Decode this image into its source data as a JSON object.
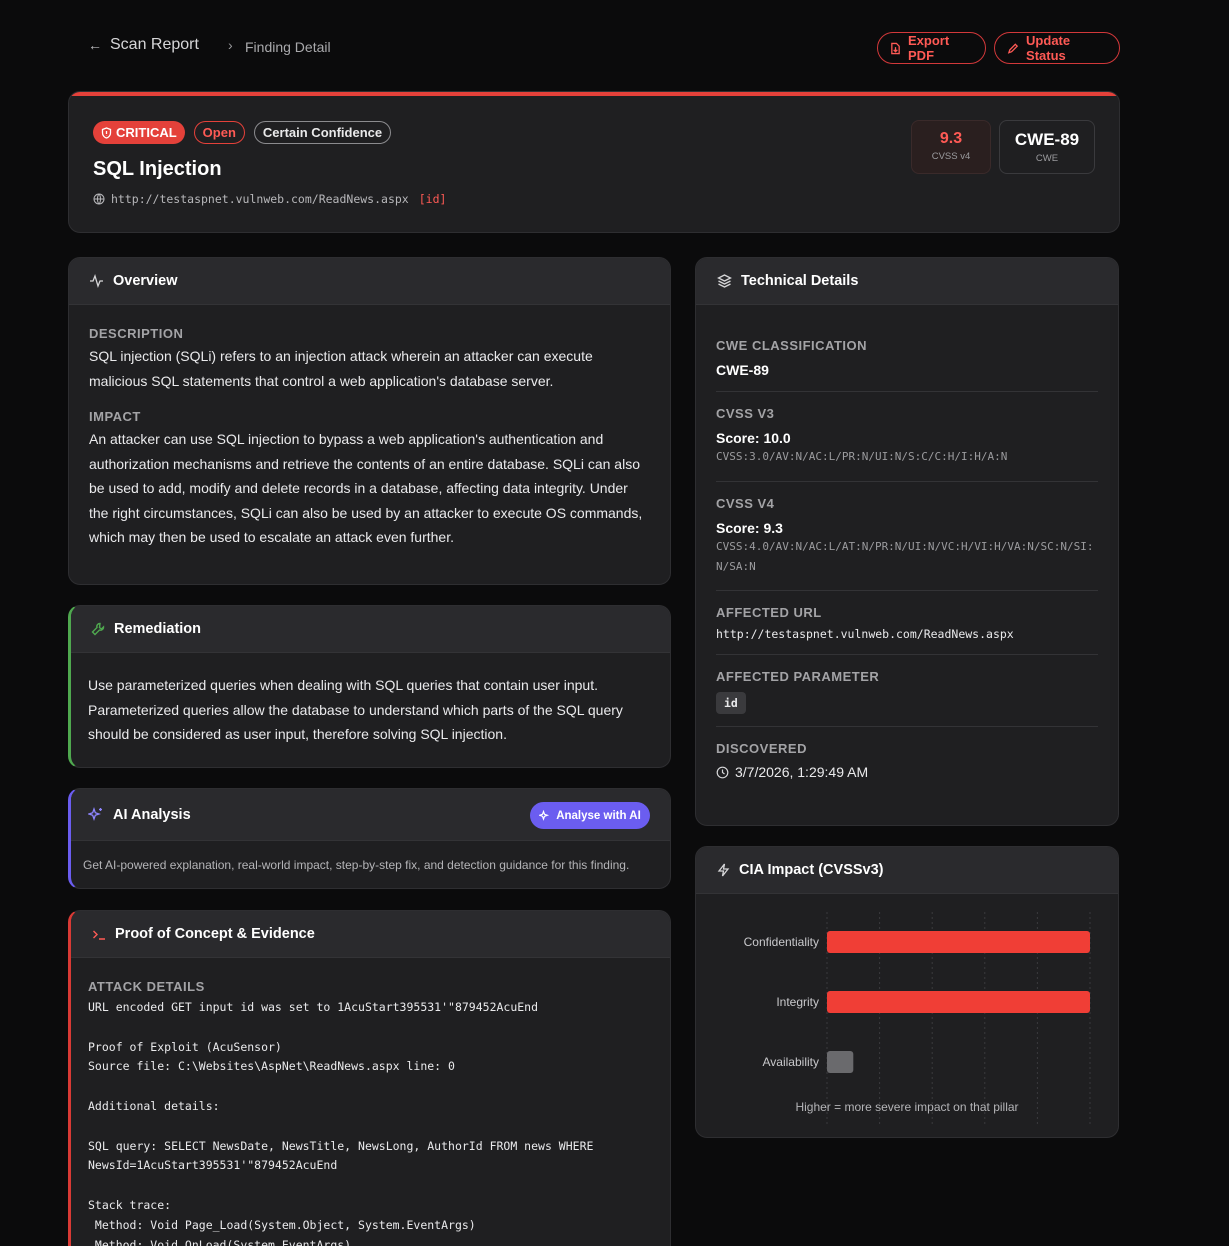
{
  "nav": {
    "back_label": "Scan Report",
    "current": "Finding Detail",
    "export_label": "Export PDF",
    "update_label": "Update Status"
  },
  "finding": {
    "severity": "CRITICAL",
    "status": "Open",
    "confidence": "Certain Confidence",
    "title": "SQL Injection",
    "url": "http://testaspnet.vulnweb.com/ReadNews.aspx",
    "param_tag": "[id]",
    "cvss_score": "9.3",
    "cvss_label": "CVSS v4",
    "cwe": "CWE-89",
    "cwe_label": "CWE"
  },
  "overview": {
    "title": "Overview",
    "description_label": "DESCRIPTION",
    "description": "SQL injection (SQLi) refers to an injection attack wherein an attacker can execute malicious SQL statements that control a web application's database server.",
    "impact_label": "IMPACT",
    "impact": "An attacker can use SQL injection to bypass a web application's authentication and authorization mechanisms and retrieve the contents of an entire database. SQLi can also be used to add, modify and delete records in a database, affecting data integrity. Under the right circumstances, SQLi can also be used by an attacker to execute OS commands, which may then be used to escalate an attack even further."
  },
  "remediation": {
    "title": "Remediation",
    "text": "Use parameterized queries when dealing with SQL queries that contain user input. Parameterized queries allow the database to understand which parts of the SQL query should be considered as user input, therefore solving SQL injection."
  },
  "ai": {
    "title": "AI Analysis",
    "button": "Analyse with AI",
    "text": "Get AI-powered explanation, real-world impact, step-by-step fix, and detection guidance for this finding."
  },
  "poc": {
    "title": "Proof of Concept & Evidence",
    "label": "ATTACK DETAILS",
    "lines": [
      "URL encoded GET input id was set to 1AcuStart395531'\"879452AcuEnd",
      "",
      "Proof of Exploit (AcuSensor)",
      "Source file: C:\\Websites\\AspNet\\ReadNews.aspx line: 0",
      "",
      "Additional details:",
      "",
      "SQL query: SELECT NewsDate, NewsTitle, NewsLong, AuthorId FROM news WHERE",
      "NewsId=1AcuStart395531'\"879452AcuEnd",
      "",
      "Stack trace:",
      " Method: Void Page_Load(System.Object, System.EventArgs)",
      " Method: Void OnLoad(System.EventArgs)"
    ]
  },
  "tech": {
    "title": "Technical Details",
    "cwe_label": "CWE CLASSIFICATION",
    "cwe_value": "CWE-89",
    "cvss3_label": "CVSS V3",
    "cvss3_score": "Score: 10.0",
    "cvss3_vector": "CVSS:3.0/AV:N/AC:L/PR:N/UI:N/S:C/C:H/I:H/A:N",
    "cvss4_label": "CVSS V4",
    "cvss4_score": "Score: 9.3",
    "cvss4_vector": "CVSS:4.0/AV:N/AC:L/AT:N/PR:N/UI:N/VC:H/VI:H/VA:N/SC:N/SI:N/SA:N",
    "url_label": "AFFECTED URL",
    "url_value": "http://testaspnet.vulnweb.com/ReadNews.aspx",
    "param_label": "AFFECTED PARAMETER",
    "param_value": "id",
    "discovered_label": "DISCOVERED",
    "discovered_value": "3/7/2026, 1:29:49 AM"
  },
  "cia": {
    "title": "CIA Impact (CVSSv3)",
    "caption": "Higher = more severe impact on that pillar"
  },
  "chart_data": {
    "type": "bar",
    "orientation": "horizontal",
    "categories": [
      "Confidentiality",
      "Integrity",
      "Availability"
    ],
    "values": [
      100,
      100,
      10
    ],
    "xlim": [
      0,
      100
    ],
    "grid": true,
    "colors": [
      "#f03e36",
      "#f03e36",
      "#6a6a6d"
    ]
  },
  "colors": {
    "accent_red": "#e4413a",
    "ai_purple": "#6b5df0",
    "remediation_green": "#4fa84f"
  }
}
